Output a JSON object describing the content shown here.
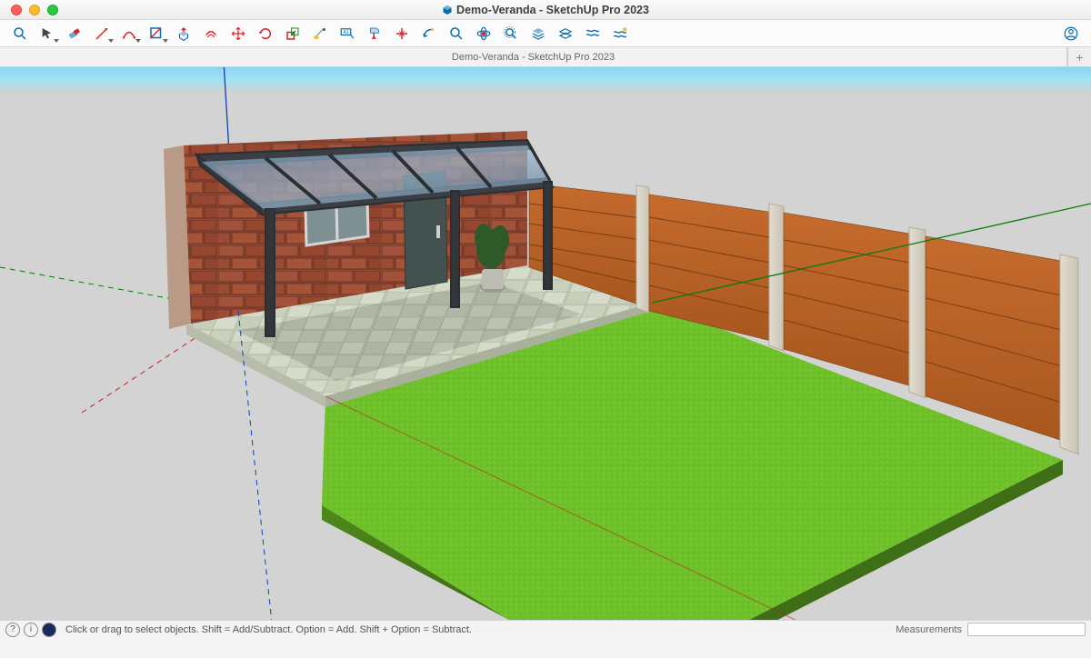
{
  "window": {
    "title": "Demo-Veranda - SketchUp Pro 2023"
  },
  "tabs": {
    "active": "Demo-Veranda - SketchUp Pro 2023"
  },
  "toolbar": {
    "items": [
      "search",
      "select",
      "eraser",
      "line",
      "arc",
      "line-style",
      "rectangle",
      "push-pull",
      "offset",
      "move",
      "rotate",
      "scale",
      "tape",
      "mirror",
      "tag",
      "section",
      "paint",
      "section-cut",
      "hide",
      "zoom",
      "orbit",
      "zoom-extents",
      "layers",
      "iso",
      "outliner",
      "extensions"
    ]
  },
  "status": {
    "help": "Click or drag to select objects. Shift = Add/Subtract. Option = Add. Shift + Option = Subtract.",
    "measurements_label": "Measurements",
    "measurements_value": ""
  },
  "scene_description": "3D perspective view of a backyard model: brick house wall with a dark-grey aluminium veranda / patio canopy, tiled patio floor, green lawn, and a wooden slat fence with concrete posts along the right side. Blue, green and red model axes visible.",
  "colors": {
    "accent_blue": "#0b6aa8",
    "red": "#d8232a",
    "green": "#2f8f2f",
    "grass": "#6fc22a",
    "brick": "#95422c",
    "fence": "#b9622a",
    "frame": "#3b3f43"
  }
}
